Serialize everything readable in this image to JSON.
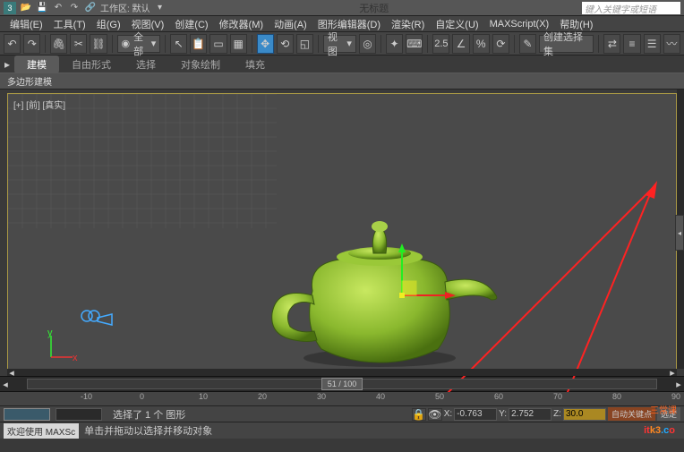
{
  "titlebar": {
    "workspace": "工作区: 默认",
    "title": "无标题",
    "search_placeholder": "键入关键字或短语"
  },
  "menubar": {
    "items": [
      "编辑(E)",
      "工具(T)",
      "组(G)",
      "视图(V)",
      "创建(C)",
      "修改器(M)",
      "动画(A)",
      "图形编辑器(D)",
      "渲染(R)",
      "自定义(U)",
      "MAXScript(X)",
      "帮助(H)"
    ]
  },
  "toolbar": {
    "combo_all": "全部",
    "combo_view": "视图",
    "scale_label": "2.5",
    "select_set": "创建选择集"
  },
  "ribbon": {
    "tabs": [
      "建模",
      "自由形式",
      "选择",
      "对象绘制",
      "填充"
    ]
  },
  "subribbon": {
    "label": "多边形建模"
  },
  "viewport": {
    "label": "[+] [前] [真实]"
  },
  "timeline": {
    "frame": "51 / 100"
  },
  "ruler": {
    "ticks": [
      "-10",
      "0",
      "10",
      "20",
      "30",
      "40",
      "50",
      "60",
      "70",
      "80",
      "90"
    ]
  },
  "status": {
    "selection": "选择了 1 个 图形",
    "coords": {
      "x": "-0.763",
      "y": "2.752",
      "z": "30.0"
    },
    "autokey": "自动关键点",
    "filter": "选定"
  },
  "hint": {
    "welcome": "欢迎使用 MAXSc",
    "tip": "单击并拖动以选择并移动对象"
  }
}
